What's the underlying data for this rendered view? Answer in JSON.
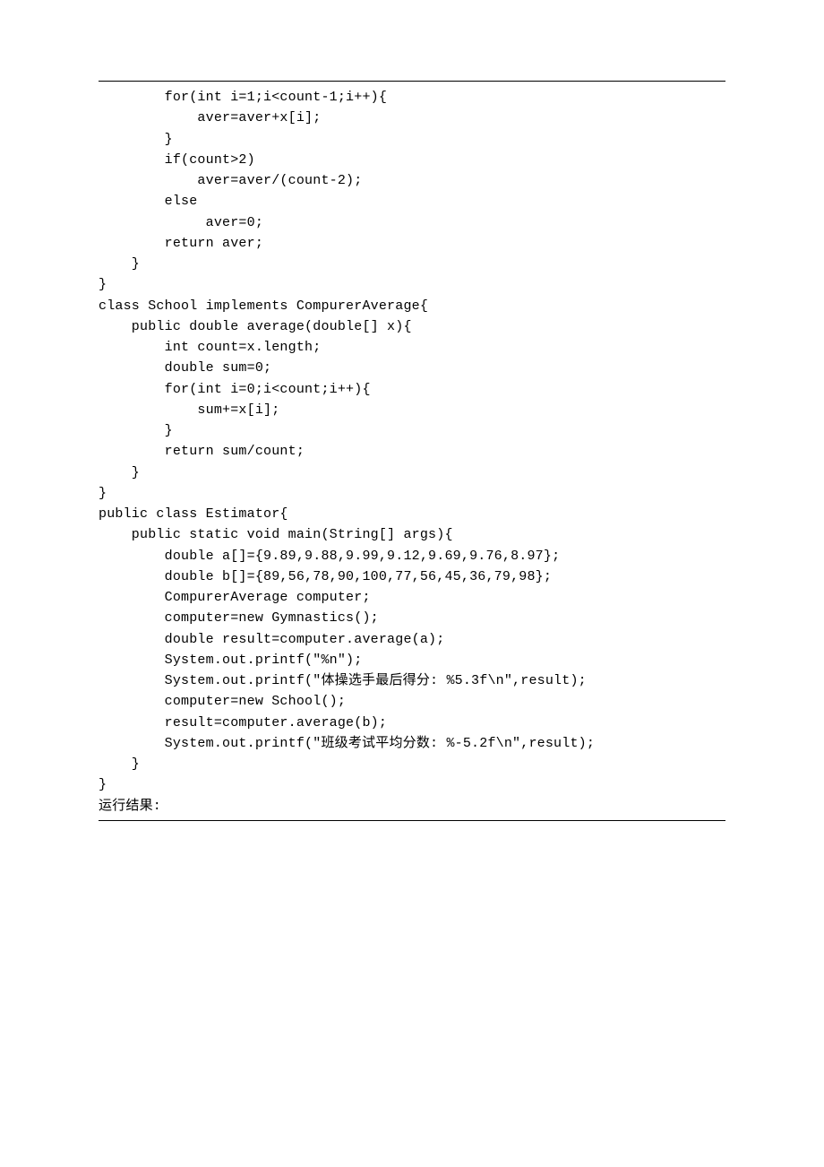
{
  "code_lines": [
    "        for(int i=1;i<count-1;i++){",
    "            aver=aver+x[i];",
    "        }",
    "        if(count>2)",
    "            aver=aver/(count-2);",
    "        else",
    "             aver=0;",
    "        return aver;",
    "    }",
    "}",
    "class School implements CompurerAverage{",
    "    public double average(double[] x){",
    "        int count=x.length;",
    "        double sum=0;",
    "        for(int i=0;i<count;i++){",
    "            sum+=x[i];",
    "        }",
    "        return sum/count;",
    "    }",
    "}",
    "public class Estimator{",
    "    public static void main(String[] args){",
    "        double a[]={9.89,9.88,9.99,9.12,9.69,9.76,8.97};",
    "        double b[]={89,56,78,90,100,77,56,45,36,79,98};",
    "        CompurerAverage computer;",
    "        computer=new Gymnastics();",
    "        double result=computer.average(a);",
    "        System.out.printf(\"%n\");",
    "        System.out.printf(\"体操选手最后得分: %5.3f\\n\",result);",
    "        computer=new School();",
    "        result=computer.average(b);",
    "        System.out.printf(\"班级考试平均分数: %-5.2f\\n\",result);",
    "    }",
    "}",
    "运行结果:"
  ]
}
